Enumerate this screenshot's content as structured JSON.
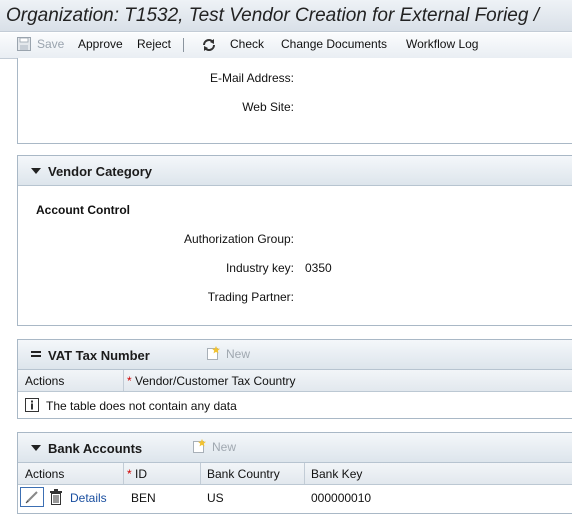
{
  "title": "Organization: T1532, Test Vendor Creation for External Forieg /",
  "toolbar": {
    "save": "Save",
    "approve": "Approve",
    "reject": "Reject",
    "check": "Check",
    "change_documents": "Change Documents",
    "workflow_log": "Workflow Log"
  },
  "address": {
    "email_label": "E-Mail Address:",
    "email_value": "",
    "website_label": "Web Site:",
    "website_value": ""
  },
  "vendor_category": {
    "title": "Vendor Category",
    "subhead": "Account Control",
    "auth_group_label": "Authorization Group:",
    "auth_group_value": "",
    "industry_key_label": "Industry key:",
    "industry_key_value": "0350",
    "trading_partner_label": "Trading Partner:",
    "trading_partner_value": ""
  },
  "vat": {
    "title": "VAT Tax Number",
    "new_label": "New",
    "columns": [
      "Actions",
      "*",
      "Vendor/Customer Tax Country"
    ],
    "empty_message": "The table does not contain any data"
  },
  "bank": {
    "title": "Bank Accounts",
    "new_label": "New",
    "columns": [
      "Actions",
      "*",
      "ID",
      "Bank Country",
      "Bank Key"
    ],
    "rows": [
      {
        "details": "Details",
        "id": "BEN",
        "country": "US",
        "bank_key": "000000010"
      }
    ]
  },
  "colors": {
    "link": "#1a4fa0",
    "required": "#cc0000",
    "border": "#a9b8c6"
  }
}
